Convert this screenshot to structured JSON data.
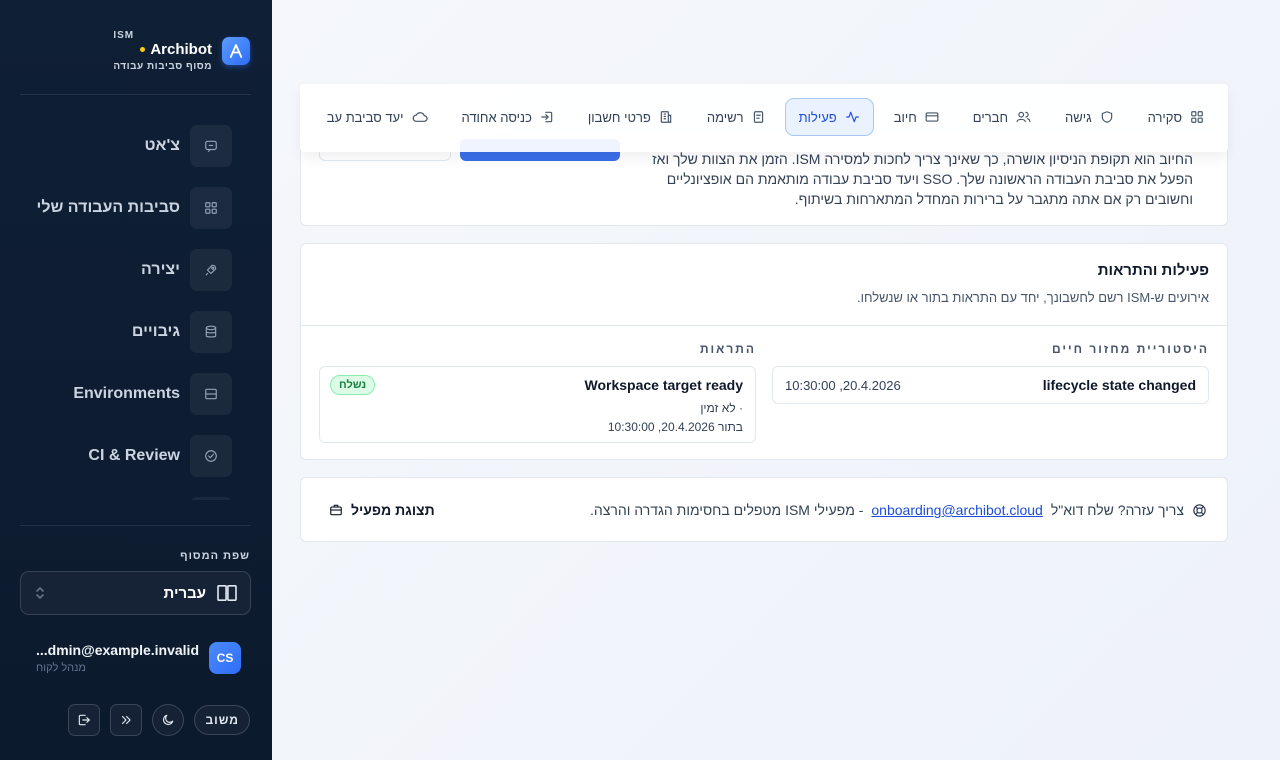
{
  "brand": {
    "ism": "ISM",
    "name": "Archibot",
    "subtitle": "מסוף סביבות עבודה"
  },
  "nav": {
    "items": [
      {
        "label": "צ'אט",
        "icon": "chat-icon"
      },
      {
        "label": "סביבות העבודה שלי",
        "icon": "grid-icon"
      },
      {
        "label": "יצירה",
        "icon": "rocket-icon"
      },
      {
        "label": "גיבויים",
        "icon": "database-icon"
      },
      {
        "label": "Environments",
        "icon": "server-icon"
      },
      {
        "label": "CI & Review",
        "icon": "check-circle-icon"
      }
    ]
  },
  "language": {
    "title": "שפת המסוף",
    "current": "עברית"
  },
  "user": {
    "initials": "CS",
    "email": "...dmin@example.invalid",
    "role": "מנהל לקוח"
  },
  "bottom": {
    "feedback_label": "משוב"
  },
  "tabs": [
    {
      "label": "סקירה",
      "icon": "grid-icon",
      "active": false
    },
    {
      "label": "גישה",
      "icon": "shield-icon",
      "active": false
    },
    {
      "label": "חברים",
      "icon": "users-icon",
      "active": false
    },
    {
      "label": "חיוב",
      "icon": "credit-card-icon",
      "active": false
    },
    {
      "label": "פעילות",
      "icon": "activity-icon",
      "active": true
    },
    {
      "label": "רשימה",
      "icon": "list-icon",
      "active": false
    },
    {
      "label": "פרטי חשבון",
      "icon": "building-icon",
      "active": false
    },
    {
      "label": "כניסה אחודה",
      "icon": "login-icon",
      "active": false
    },
    {
      "label": "יעד סביבת עב",
      "icon": "cloud-icon",
      "active": false
    }
  ],
  "billing_card": {
    "text": "החיוב הוא תקופת הניסיון אושרה, כך שאינך צריך לחכות למסירה ISM. הזמן את הצוות שלך ואז הפעל את סביבת העבודה הראשונה שלך. SSO ויעד סביבת עבודה מותאמת הם אופציונליים וחשובים רק אם אתה מתגבר על ברירות המחדל המתארחות בשיתוף."
  },
  "activity": {
    "title": "פעילות והתראות",
    "description": "אירועים ש-ISM רשם לחשבונך, יחד עם התראות בתור או שנשלחו.",
    "history_title": "היסטוריית מחזור חיים",
    "notifications_title": "התראות",
    "history_items": [
      {
        "label": "lifecycle state changed",
        "time": "20.4.2026, 10:30:00"
      }
    ],
    "notifications": [
      {
        "title": "Workspace target ready",
        "sub": "· לא זמין",
        "time": "בתור 20.4.2026, 10:30:00",
        "badge": "נשלח"
      }
    ]
  },
  "help": {
    "prefix": "צריך עזרה? שלח דוא\"ל",
    "email": "onboarding@archibot.cloud",
    "suffix": "-  מפעילי ISM מטפלים בחסימות הגדרה והרצה.",
    "operator_label": "תצוגת מפעיל"
  }
}
